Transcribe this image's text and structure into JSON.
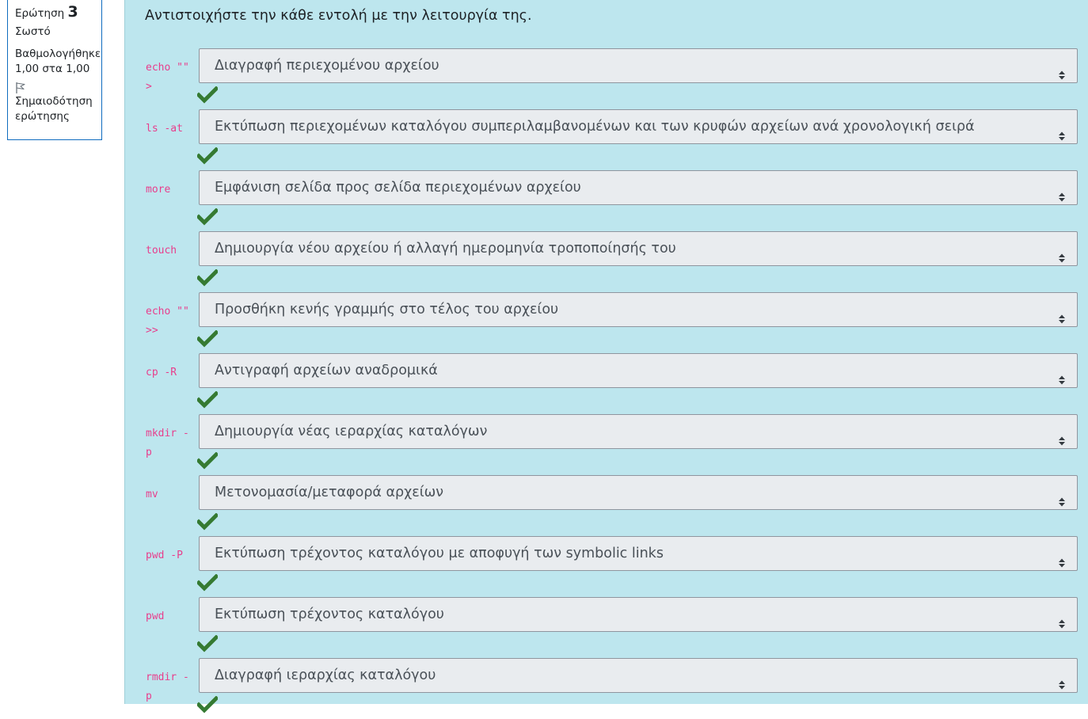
{
  "info": {
    "question_label": "Ερώτηση",
    "question_number": "3",
    "state": "Σωστό",
    "grade": "Βαθμολογήθηκε 1,00 στα 1,00",
    "flag_label": "Σημαιοδότηση ερώτησης",
    "flag_icon": "flag-icon"
  },
  "question_text": "Αντιστοιχήστε την κάθε εντολή με την λειτουργία της.",
  "colors": {
    "content_bg": "#bde6ee",
    "command": "#e83e8c",
    "check": "#357a32",
    "select_bg": "#e9ecef"
  },
  "rows": [
    {
      "command": "echo \"\" >",
      "answer": "Διαγραφή περιεχομένου αρχείου"
    },
    {
      "command": "ls -at",
      "answer": "Εκτύπωση περιεχομένων καταλόγου συμπεριλαμβανομένων και των κρυφών αρχείων ανά χρονολογική σειρά"
    },
    {
      "command": "more",
      "answer": "Εμφάνιση σελίδα προς σελίδα περιεχομένων αρχείου"
    },
    {
      "command": "touch",
      "answer": "Δημιουργία νέου αρχείου ή αλλαγή ημερομηνία τροποποίησής του"
    },
    {
      "command": "echo \"\" >>",
      "answer": "Προσθήκη κενής γραμμής στο τέλος του αρχείου"
    },
    {
      "command": "cp -R",
      "answer": "Αντιγραφή αρχείων αναδρομικά"
    },
    {
      "command": "mkdir -p",
      "answer": "Δημιουργία νέας ιεραρχίας καταλόγων"
    },
    {
      "command": "mv",
      "answer": "Μετονομασία/μεταφορά αρχείων"
    },
    {
      "command": "pwd -P",
      "answer": "Εκτύπωση τρέχοντος καταλόγου με αποφυγή των symbolic links"
    },
    {
      "command": "pwd",
      "answer": "Εκτύπωση τρέχοντος καταλόγου"
    },
    {
      "command": "rmdir -p",
      "answer": "Διαγραφή ιεραρχίας καταλόγου"
    }
  ]
}
